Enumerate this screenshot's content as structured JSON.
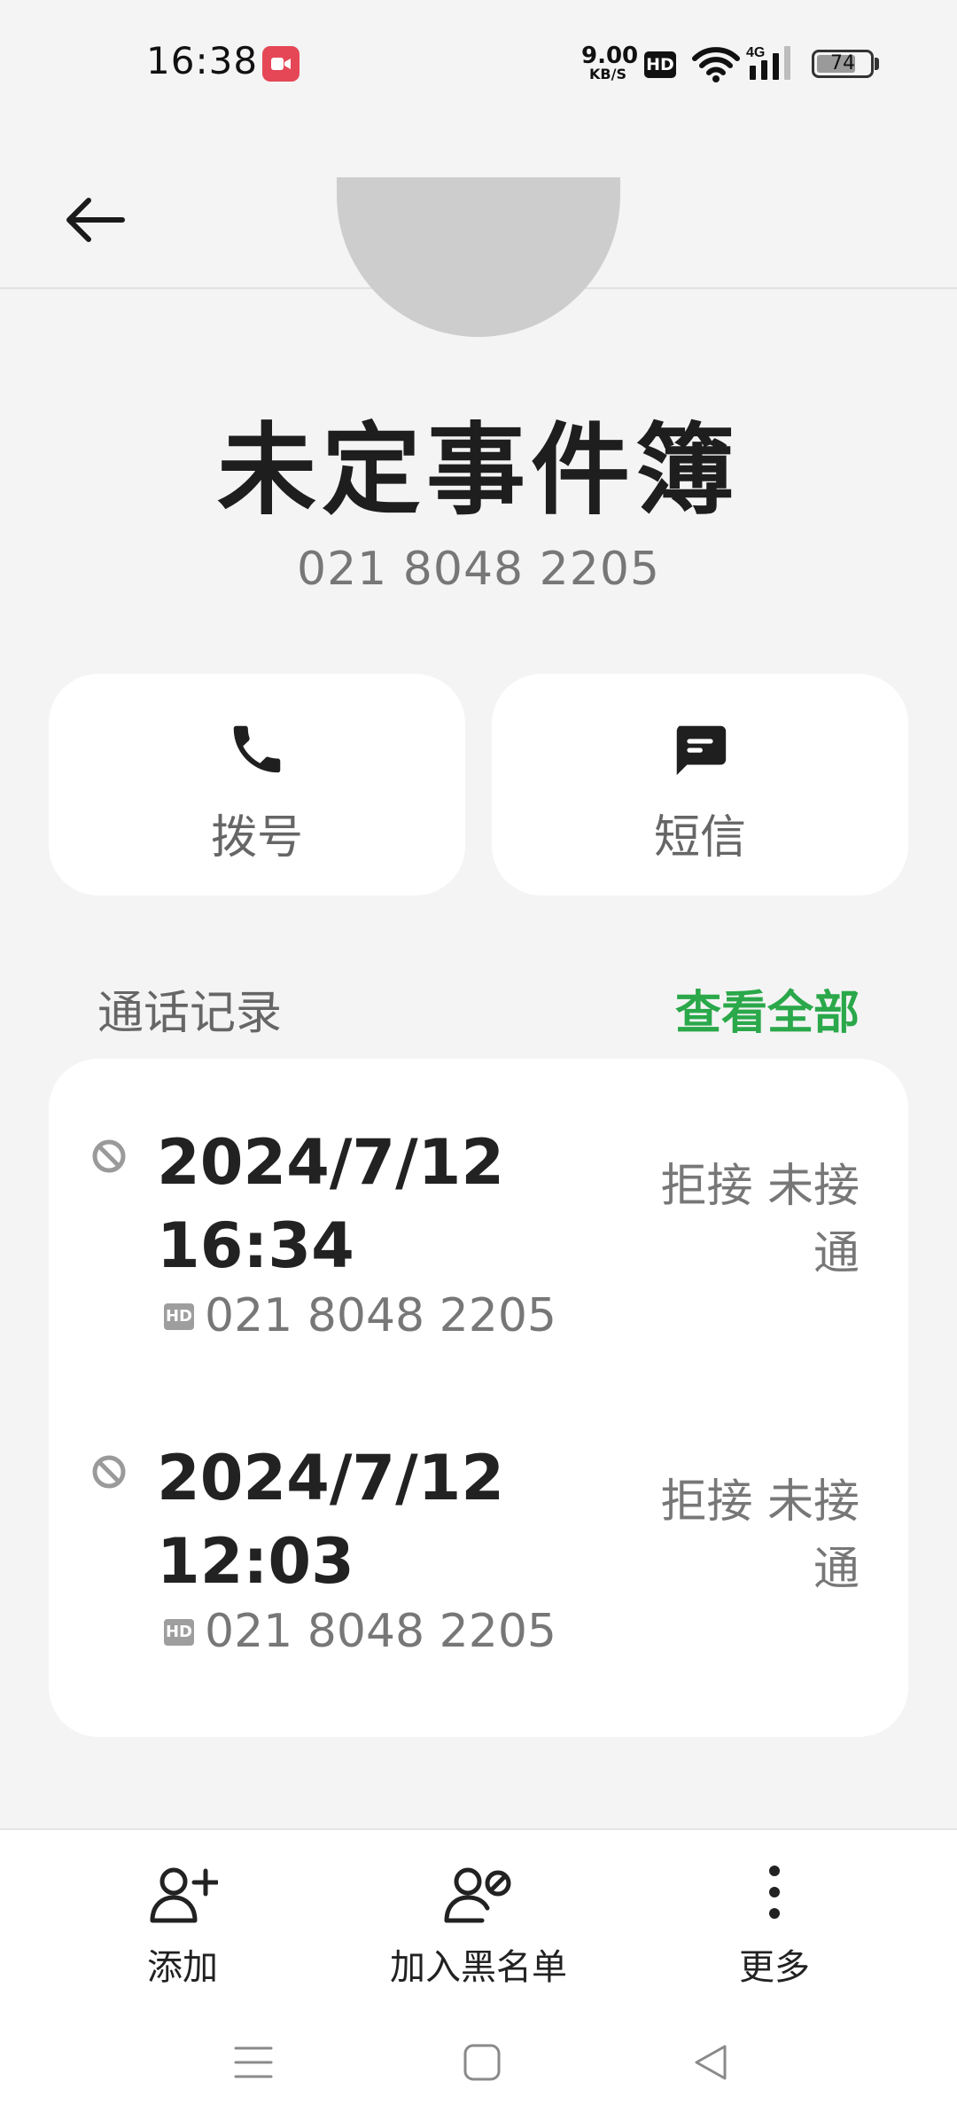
{
  "status_bar": {
    "time": "16:38",
    "net_speed_value": "9.00",
    "net_speed_unit": "KB/S",
    "hd_label": "HD",
    "network_type": "4G",
    "battery_level": "74",
    "battery_fraction": 0.74
  },
  "contact": {
    "name": "未定事件簿",
    "number": "021 8048 2205"
  },
  "actions": {
    "dial_label": "拨号",
    "sms_label": "短信"
  },
  "call_log": {
    "title": "通话记录",
    "view_all_label": "查看全部",
    "entries": [
      {
        "date": "2024/7/12",
        "time": "16:34",
        "hd_label": "HD",
        "number": "021 8048 2205",
        "status_line1": "拒接 未接",
        "status_line2": "通"
      },
      {
        "date": "2024/7/12",
        "time": "12:03",
        "hd_label": "HD",
        "number": "021 8048 2205",
        "status_line1": "拒接 未接",
        "status_line2": "通"
      }
    ]
  },
  "bottom_actions": {
    "add_label": "添加",
    "blacklist_label": "加入黑名单",
    "more_label": "更多"
  },
  "colors": {
    "accent_green": "#2aa84a",
    "record_red": "#e54756",
    "background": "#f4f4f4"
  },
  "icons": {
    "back": "arrow-left-icon",
    "dial": "phone-icon",
    "sms": "message-icon",
    "call_blocked": "block-icon",
    "add": "person-add-icon",
    "blacklist": "person-block-icon",
    "more": "more-vertical-icon"
  }
}
